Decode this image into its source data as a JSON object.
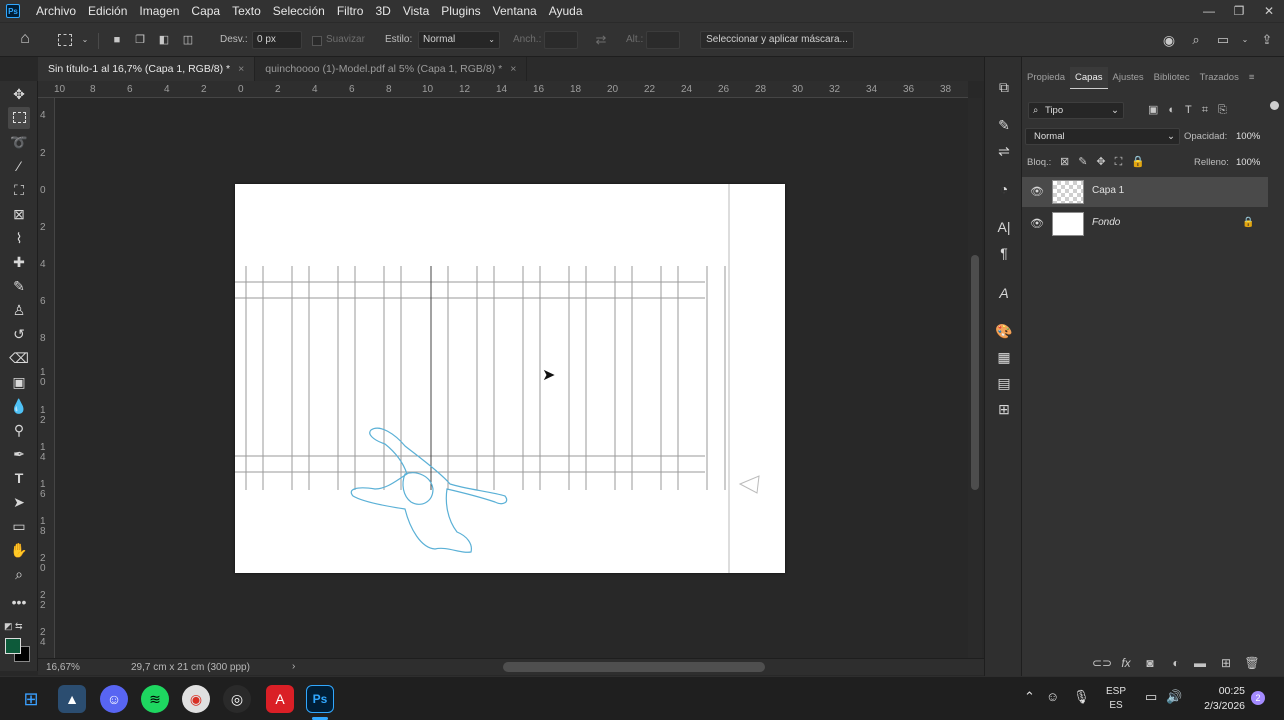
{
  "app": {
    "logo_text": "Ps"
  },
  "menu": [
    "Archivo",
    "Edición",
    "Imagen",
    "Capa",
    "Texto",
    "Selección",
    "Filtro",
    "3D",
    "Vista",
    "Plugins",
    "Ventana",
    "Ayuda"
  ],
  "window_controls": {
    "minimize": "—",
    "restore": "❐",
    "close": "✕"
  },
  "options": {
    "feather_label": "Desv.:",
    "feather_value": "0 px",
    "antialias_label": "Suavizar",
    "style_label": "Estilo:",
    "style_value": "Normal",
    "width_label": "Anch.:",
    "height_label": "Alt.:",
    "select_mask_button": "Seleccionar y aplicar máscara..."
  },
  "tabs": [
    {
      "label": "Sin título-1 al 16,7% (Capa 1, RGB/8) *",
      "close": "×",
      "active": true
    },
    {
      "label": "quinchoooo (1)-Model.pdf al 5% (Capa 1, RGB/8) *",
      "close": "×",
      "active": false
    }
  ],
  "ruler_h": [
    "10",
    "8",
    "6",
    "4",
    "2",
    "0",
    "2",
    "4",
    "6",
    "8",
    "10",
    "12",
    "14",
    "16",
    "18",
    "20",
    "22",
    "24",
    "26",
    "28",
    "30",
    "32",
    "34",
    "36",
    "38"
  ],
  "ruler_v": [
    "4",
    "2",
    "0",
    "2",
    "4",
    "6",
    "8",
    "1 0",
    "1 2",
    "1 4",
    "1 6",
    "1 8",
    "2 0",
    "2 2",
    "2 4"
  ],
  "status": {
    "zoom": "16,67%",
    "doc_info": "29,7 cm x 21 cm (300 ppp)",
    "arrow": "›"
  },
  "panels": {
    "tabs": [
      "Propieda",
      "Capas",
      "Ajustes",
      "Bibliotec",
      "Trazados"
    ],
    "active_tab": "Capas",
    "filter_label": "Tipo",
    "blend_mode": "Normal",
    "opacity_label": "Opacidad:",
    "opacity_value": "100%",
    "lock_label": "Bloq.:",
    "fill_label": "Relleno:",
    "fill_value": "100%",
    "layers": [
      {
        "name": "Capa 1",
        "selected": true
      },
      {
        "name": "Fondo",
        "selected": false,
        "locked": true
      }
    ]
  },
  "taskbar": {
    "language_top": "ESP",
    "language_bottom": "ES",
    "time": "00:25",
    "date": "2/3/2026",
    "notification_count": "2",
    "ps_label": "Ps"
  },
  "colors": {
    "accent": "#31a8ff",
    "panel": "#323232",
    "canvas_bg": "#282828",
    "sketch": "#5ab0d6"
  }
}
